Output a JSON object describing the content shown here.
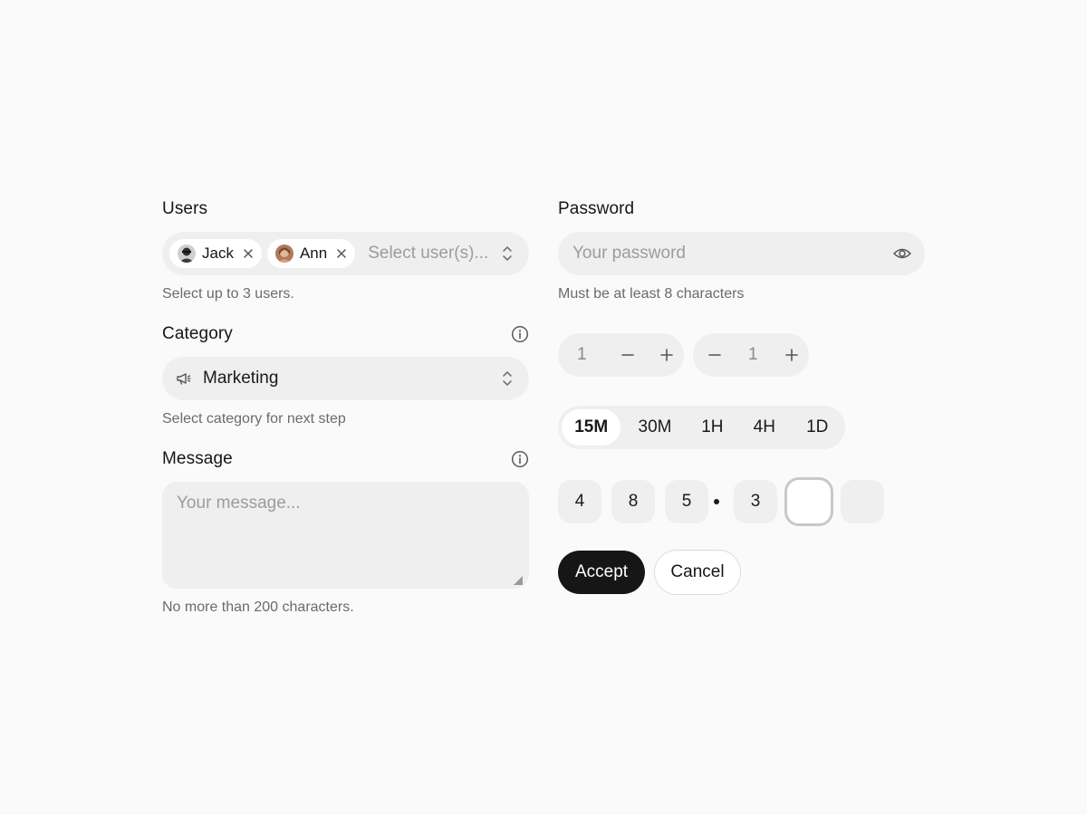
{
  "users": {
    "label": "Users",
    "chips": [
      {
        "name": "Jack",
        "avatar_color": "#3a3a3a"
      },
      {
        "name": "Ann",
        "avatar_color": "#a0664a"
      }
    ],
    "placeholder": "Select user(s)...",
    "hint": "Select up to 3 users."
  },
  "category": {
    "label": "Category",
    "value": "Marketing",
    "icon": "megaphone-icon",
    "hint": "Select category for next step"
  },
  "message": {
    "label": "Message",
    "placeholder": "Your message...",
    "hint": "No more than 200 characters."
  },
  "password": {
    "label": "Password",
    "placeholder": "Your password",
    "hint": "Must be at least 8 characters"
  },
  "steppers": [
    {
      "value": "1"
    },
    {
      "value": "1"
    }
  ],
  "segmented": {
    "options": [
      "15M",
      "30M",
      "1H",
      "4H",
      "1D"
    ],
    "selected": "15M"
  },
  "otp": {
    "digits": [
      "4",
      "8",
      "5",
      "3",
      "",
      ""
    ]
  },
  "actions": {
    "accept": "Accept",
    "cancel": "Cancel"
  }
}
